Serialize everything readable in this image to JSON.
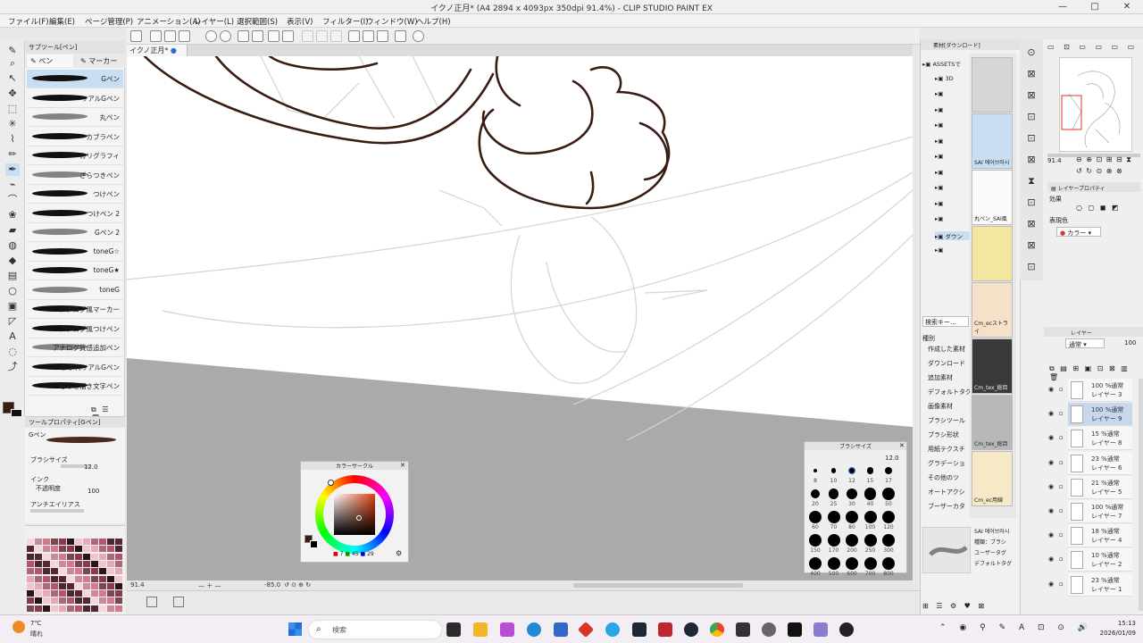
{
  "window": {
    "title": "イクノ正月* (A4 2894 x 4093px 350dpi 91.4%) - CLIP STUDIO PAINT EX"
  },
  "menu": [
    "ファイル(F)",
    "編集(E)",
    "ページ管理(P)",
    "アニメーション(A)",
    "レイヤー(L)",
    "選択範囲(S)",
    "表示(V)",
    "フィルター(I)",
    "ウィンドウ(W)",
    "ヘルプ(H)"
  ],
  "doc_tab": "イクノ正月*",
  "subtool": {
    "header": "サブツール[ペン]",
    "tabs": [
      "ペン",
      "マーカー"
    ],
    "brushes": [
      "Gペン",
      "リアルGペン",
      "丸ペン",
      "カブラペン",
      "カリグラフィ",
      "ざらつきペン",
      "つけペン",
      "つけペン 2",
      "Gペン 2",
      "toneG☆",
      "toneG★",
      "toneG",
      "アナログ風マーカー",
      "アナログ風つけペン",
      "アナログ質感追加ペン",
      "かすれリアルGペン",
      "もっと描き文字ペン"
    ],
    "selected_index": 0
  },
  "tool_property": {
    "header": "ツールプロパティ[Gペン]",
    "tool_name": "Gペン",
    "brush_size_label": "ブラシサイズ",
    "brush_size_value": "12.0",
    "ink_label": "インク",
    "opacity_label": "不透明度",
    "opacity_value": "100",
    "antialias_label": "アンチエイリアス"
  },
  "status": {
    "zoom": "91.4",
    "angle": "-85.0"
  },
  "color_circle": {
    "title": "カラーサークル",
    "h": "7",
    "s": "45",
    "v": "29"
  },
  "brush_size_palette": {
    "title": "ブラシサイズ",
    "current": "12.0",
    "sizes": [
      "8",
      "10",
      "12",
      "15",
      "17",
      "20",
      "25",
      "30",
      "40",
      "50",
      "60",
      "70",
      "80",
      "100",
      "120",
      "150",
      "170",
      "200",
      "250",
      "300",
      "400",
      "500",
      "600",
      "700",
      "800"
    ]
  },
  "material": {
    "header": "素材[ダウンロード]",
    "tree": [
      "ASSETSで",
      "3D",
      "",
      "",
      "",
      "",
      "",
      "",
      "",
      "",
      "",
      "ダウン",
      ""
    ],
    "search": "検索キー...",
    "categories_header": "種別",
    "categories": [
      "作成した素材",
      "ダウンロード",
      "追加素材",
      "デフォルトタグ",
      "画像素材",
      "ブラシツール",
      "ブラシ形状",
      "用紙テクスチ",
      "グラデーショ",
      "その他のツ",
      "オートアクシ",
      "ブーザーカタ"
    ],
    "thumbs": [
      "",
      "SAI 에어브러시",
      "丸ペン_SAI風",
      "",
      "Cm_ecストライ",
      "Cm_tex_総目",
      "Cm_tex_総目",
      "Cm_ec用線"
    ],
    "detail_title": "SAI 에어브러시",
    "detail_kind": "種類：ブラシ",
    "detail_user": "ユーザータグ",
    "detail_tag": "デフォルトタグ"
  },
  "layer_property": {
    "header": "レイヤープロパティ",
    "effect_label": "効果",
    "expression_label": "表現色",
    "expression_value": "カラー"
  },
  "layers_panel": {
    "header": "レイヤー",
    "blend_mode": "通常",
    "opacity": "100",
    "layers": [
      {
        "pct": "100 %通常",
        "name": "レイヤー 3"
      },
      {
        "pct": "100 %通常",
        "name": "レイヤー 9"
      },
      {
        "pct": "15 %通常",
        "name": "レイヤー 8"
      },
      {
        "pct": "23 %通常",
        "name": "レイヤー 6"
      },
      {
        "pct": "21 %通常",
        "name": "レイヤー 5"
      },
      {
        "pct": "100 %通常",
        "name": "レイヤー 7"
      },
      {
        "pct": "18 %通常",
        "name": "レイヤー 4"
      },
      {
        "pct": "10 %通常",
        "name": "レイヤー 2"
      },
      {
        "pct": "23 %通常",
        "name": "レイヤー 1"
      }
    ],
    "selected_index": 1
  },
  "taskbar": {
    "weather_temp": "7℃",
    "weather_desc": "晴れ",
    "search_placeholder": "検索",
    "time": "15:13",
    "date": "2026/01/09"
  },
  "colors": {
    "accent": "#2b6fd6",
    "selected_bg": "#c8def3",
    "canvas_gray": "#aaaaaa",
    "line_brown": "#3a1d12"
  }
}
